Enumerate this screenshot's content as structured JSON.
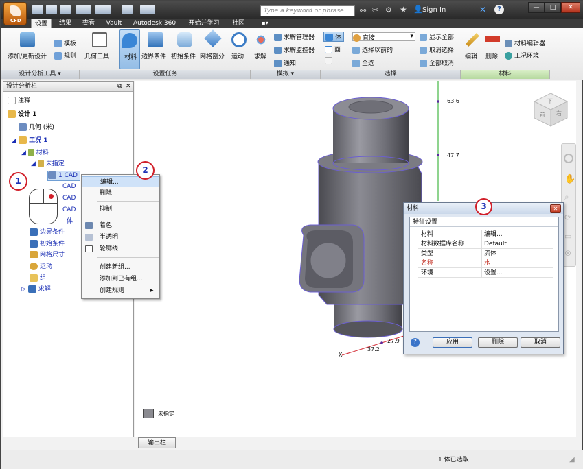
{
  "titlebar": {
    "app_name": "CFD",
    "search_placeholder": "Type a keyword or phrase",
    "sign_in": "Sign In"
  },
  "tabs": [
    "设置",
    "结果",
    "查看",
    "Vault",
    "Autodesk 360",
    "开始并学习",
    "社区"
  ],
  "ribbon": {
    "design_tools": {
      "add_update": "添加/更新设计",
      "template": "模板",
      "rules": "规则",
      "panel": "设计分析工具"
    },
    "setup_tasks": {
      "geometry": "几何工具",
      "material": "材料",
      "boundary": "边界条件",
      "initial": "初始条件",
      "mesh": "网格剖分",
      "motion": "运动",
      "panel": "设置任务"
    },
    "simulate": {
      "solve": "求解",
      "solve_manager": "求解管理器",
      "solve_monitor": "求解监控器",
      "notify": "通知",
      "panel": "模拟"
    },
    "selection": {
      "body": "体",
      "face": "面",
      "direct": "直接",
      "select_previous": "选择以前的",
      "select_all": "全选",
      "show_all": "显示全部",
      "deselect": "取消选择",
      "deselect_all": "全部取消",
      "panel": "选择"
    },
    "material_panel": {
      "edit": "编辑",
      "delete": "删除",
      "material_editor": "材料编辑器",
      "environment": "工况环境",
      "panel": "材料"
    }
  },
  "browser": {
    "title": "设计分析栏",
    "nodes": {
      "notes": "注释",
      "design1": "设计 1",
      "geometry": "几何 (米)",
      "scenario1": "工况 1",
      "materials": "材料",
      "unassigned": "未指定",
      "cad1": "1 CAD",
      "cad2": "CAD",
      "cad3": "CAD",
      "cad4": "CAD",
      "body": "体",
      "boundary": "边界条件",
      "initial": "初始条件",
      "mesh": "网格尺寸",
      "motion": "运动",
      "group": "组",
      "solve": "求解"
    }
  },
  "context_menu": [
    "编辑...",
    "删除",
    "抑制",
    "着色",
    "半透明",
    "轮廓线",
    "创建新组...",
    "添加到已有组...",
    "创建规则"
  ],
  "viewport": {
    "axis_labels": [
      "63.6",
      "47.7",
      "27.9",
      "37.2",
      "X"
    ],
    "legend": "未指定",
    "viewcube": {
      "top": "下",
      "front": "前",
      "right": "右"
    }
  },
  "dialog": {
    "title": "材料",
    "section": "特征设置",
    "rows": [
      {
        "key": "材料",
        "value": "编辑..."
      },
      {
        "key": "材料数据库名称",
        "value": "Default"
      },
      {
        "key": "类型",
        "value": "流体"
      },
      {
        "key": "名称",
        "value": "水"
      },
      {
        "key": "环境",
        "value": "设置..."
      }
    ],
    "apply": "应用",
    "delete": "删除",
    "cancel": "取消"
  },
  "callouts": [
    "1",
    "2",
    "3"
  ],
  "output_button": "输出栏",
  "status": "1 体已选取",
  "colors": {
    "accent_red": "#d1202a",
    "tree_blue": "#1b2fb5",
    "axis_green": "#1faa1f"
  }
}
